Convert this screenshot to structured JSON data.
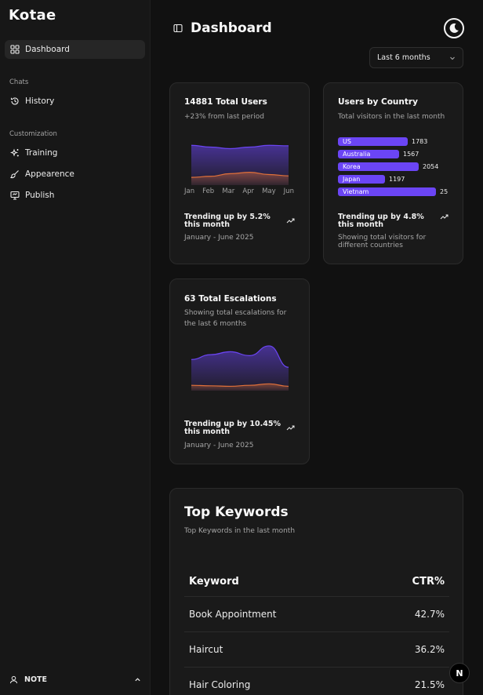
{
  "app": {
    "brand": "Kotae"
  },
  "sidebar": {
    "dashboard_label": "Dashboard",
    "chats_group": "Chats",
    "history_label": "History",
    "customization_group": "Customization",
    "training_label": "Training",
    "appearance_label": "Appearence",
    "publish_label": "Publish",
    "user_name": "NOTE"
  },
  "header": {
    "title": "Dashboard",
    "period_select": "Last 6 months",
    "theme_icon": "moon-icon"
  },
  "users_card": {
    "title": "14881 Total Users",
    "subtitle": "+23% from last period",
    "trend": "Trending up by 5.2% this month",
    "range": "January - June 2025"
  },
  "country_card": {
    "title": "Users by Country",
    "subtitle": "Total visitors in the last month",
    "trend": "Trending up by 4.8% this month",
    "footer": "Showing total visitors for different countries"
  },
  "escalations_card": {
    "title": "63 Total Escalations",
    "subtitle": "Showing total escalations for the last 6 months",
    "trend": "Trending up by 10.45% this month",
    "range": "January - June 2025"
  },
  "keywords": {
    "title": "Top Keywords",
    "subtitle": "Top Keywords in the last month",
    "col_keyword": "Keyword",
    "col_ctr": "CTR%",
    "rows": [
      {
        "keyword": "Book Appointment",
        "ctr": "42.7%"
      },
      {
        "keyword": "Haircut",
        "ctr": "36.2%"
      },
      {
        "keyword": "Hair Coloring",
        "ctr": "21.5%"
      }
    ]
  },
  "badge": {
    "label": "N"
  },
  "colors": {
    "accent": "#6b45f5",
    "secondary": "#e0703a",
    "background": "#111111",
    "card": "#1a1a1a"
  },
  "chart_data": [
    {
      "type": "area",
      "categories": [
        "Jan",
        "Feb",
        "Mar",
        "Apr",
        "May",
        "Jun"
      ],
      "series": [
        {
          "values": [
            180,
            172,
            165,
            172,
            180,
            178
          ]
        },
        {
          "values": [
            35,
            40,
            52,
            58,
            48,
            42
          ]
        }
      ],
      "ylim": [
        0,
        220
      ],
      "grid": false
    },
    {
      "type": "bar",
      "orientation": "horizontal",
      "categories": [
        "US",
        "Australia",
        "Korea",
        "Japan",
        "Vietnam"
      ],
      "values": [
        1783,
        1567,
        2054,
        1197,
        2500
      ],
      "value_labels": [
        "1783",
        "1567",
        "2054",
        "1197",
        "25"
      ],
      "xlim": [
        0,
        2600
      ]
    },
    {
      "type": "area",
      "series": [
        {
          "values": [
            3.2,
            3.7,
            4.0,
            3.6,
            4.6,
            2.4
          ]
        },
        {
          "values": [
            0.55,
            0.5,
            0.45,
            0.55,
            0.7,
            0.45
          ]
        }
      ],
      "ylim": [
        0,
        5
      ],
      "grid": false
    }
  ]
}
